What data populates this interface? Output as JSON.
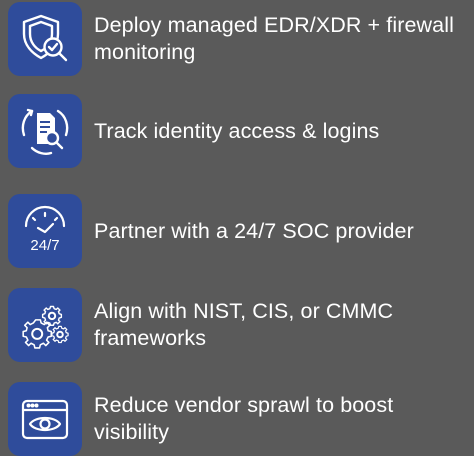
{
  "items": [
    {
      "icon": "shield-check-search-icon",
      "text": "Deploy managed EDR/XDR + firewall monitoring"
    },
    {
      "icon": "document-search-icon",
      "text": "Track identity access & logins"
    },
    {
      "icon": "clock-24-7-icon",
      "text": "Partner with a 24/7 SOC provider"
    },
    {
      "icon": "gears-icon",
      "text": "Align with NIST, CIS, or CMMC frameworks"
    },
    {
      "icon": "browser-eye-icon",
      "text": "Reduce vendor sprawl to boost visibility"
    }
  ],
  "icon_glyphs": {
    "clock_text": "24/7"
  },
  "colors": {
    "background": "#5a5a5a",
    "tile": "#2f4c9b",
    "text": "#ffffff"
  }
}
